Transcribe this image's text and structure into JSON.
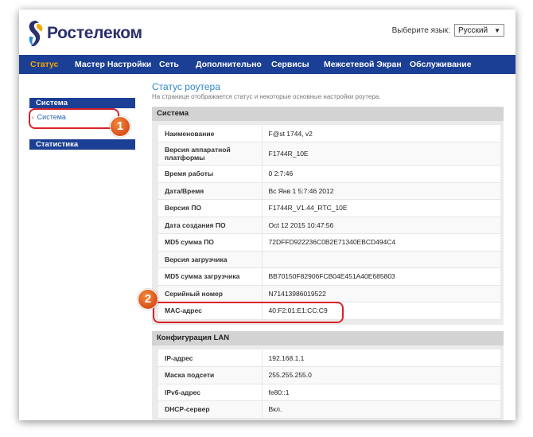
{
  "brand": {
    "name": "Ростелеком"
  },
  "language": {
    "label": "Выберите язык:",
    "selected": "Русский"
  },
  "nav": {
    "items": [
      {
        "label": "Статус",
        "active": true
      },
      {
        "label": "Мастер Настройки"
      },
      {
        "label": "Сеть"
      },
      {
        "label": "Дополнительно"
      },
      {
        "label": "Сервисы"
      },
      {
        "label": "Межсетевой Экран"
      },
      {
        "label": "Обслуживание"
      }
    ]
  },
  "sidebar": {
    "system_header": "Система",
    "system_item": "Система",
    "stats_header": "Статистика"
  },
  "main": {
    "title": "Статус роутера",
    "subtitle": "На странице отображается статус и некоторые основные настройки роутера.",
    "system": {
      "header": "Система",
      "rows": [
        {
          "key": "Наименование",
          "value": "F@st 1744, v2"
        },
        {
          "key": "Версия аппаратной платформы",
          "value": "F1744R_10E"
        },
        {
          "key": "Время работы",
          "value": "0 2:7:46"
        },
        {
          "key": "Дата/Время",
          "value": "Вс Янв 1 5:7:46 2012"
        },
        {
          "key": "Версия ПО",
          "value": "F1744R_V1.44_RTC_10E"
        },
        {
          "key": "Дата создания ПО",
          "value": "Oct 12 2015 10:47:56"
        },
        {
          "key": "MD5 сумма ПО",
          "value": "72DFFD922236C0B2E71340EBCD494C4"
        },
        {
          "key": "Версия загрузчика",
          "value": ""
        },
        {
          "key": "MD5 сумма загрузчика",
          "value": "BB70150F82906FCB04E451A40E685803"
        },
        {
          "key": "Серийный номер",
          "value": "N71413986019522"
        },
        {
          "key": "MAC-адрес",
          "value": "40:F2:01:E1:CC:C9"
        }
      ]
    },
    "lan": {
      "header": "Конфигурация LAN",
      "rows": [
        {
          "key": "IP-адрес",
          "value": "192.168.1.1"
        },
        {
          "key": "Маска подсети",
          "value": "255.255.255.0"
        },
        {
          "key": "IPv6-адрес",
          "value": "fe80::1"
        },
        {
          "key": "DHCP-сервер",
          "value": "Вкл."
        }
      ]
    }
  },
  "annotations": [
    {
      "number": "1"
    },
    {
      "number": "2"
    }
  ],
  "colors": {
    "nav_bg": "#1b3f94",
    "nav_active": "#f7a600",
    "title": "#2f8ac7",
    "annotation": "#d9232b"
  }
}
